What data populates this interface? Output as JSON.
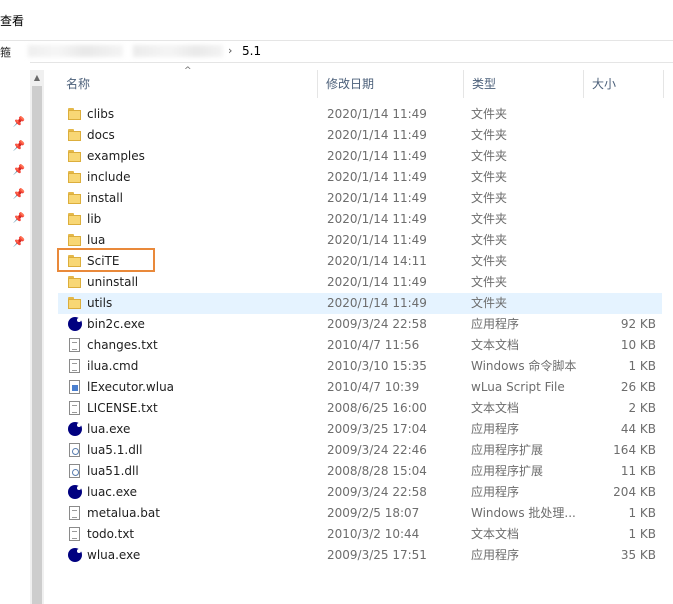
{
  "ribbon": {
    "view_tab": "查看"
  },
  "address": {
    "part0": "箍",
    "separator": "›",
    "current": "5.1"
  },
  "columns": {
    "name": "名称",
    "date": "修改日期",
    "type": "类型",
    "size": "大小"
  },
  "files": [
    {
      "name": "clibs",
      "date": "2020/1/14 11:49",
      "type": "文件夹",
      "size": "",
      "icon": "folder-icon"
    },
    {
      "name": "docs",
      "date": "2020/1/14 11:49",
      "type": "文件夹",
      "size": "",
      "icon": "folder-icon"
    },
    {
      "name": "examples",
      "date": "2020/1/14 11:49",
      "type": "文件夹",
      "size": "",
      "icon": "folder-icon"
    },
    {
      "name": "include",
      "date": "2020/1/14 11:49",
      "type": "文件夹",
      "size": "",
      "icon": "folder-icon"
    },
    {
      "name": "install",
      "date": "2020/1/14 11:49",
      "type": "文件夹",
      "size": "",
      "icon": "folder-icon"
    },
    {
      "name": "lib",
      "date": "2020/1/14 11:49",
      "type": "文件夹",
      "size": "",
      "icon": "folder-icon"
    },
    {
      "name": "lua",
      "date": "2020/1/14 11:49",
      "type": "文件夹",
      "size": "",
      "icon": "folder-icon"
    },
    {
      "name": "SciTE",
      "date": "2020/1/14 14:11",
      "type": "文件夹",
      "size": "",
      "icon": "folder-icon"
    },
    {
      "name": "uninstall",
      "date": "2020/1/14 11:49",
      "type": "文件夹",
      "size": "",
      "icon": "folder-icon"
    },
    {
      "name": "utils",
      "date": "2020/1/14 11:49",
      "type": "文件夹",
      "size": "",
      "icon": "folder-icon"
    },
    {
      "name": "bin2c.exe",
      "date": "2009/3/24 22:58",
      "type": "应用程序",
      "size": "92 KB",
      "icon": "lua-exe-icon"
    },
    {
      "name": "changes.txt",
      "date": "2010/4/7 11:56",
      "type": "文本文档",
      "size": "10 KB",
      "icon": "text-file-icon"
    },
    {
      "name": "ilua.cmd",
      "date": "2010/3/10 15:35",
      "type": "Windows 命令脚本",
      "size": "1 KB",
      "icon": "script-file-icon"
    },
    {
      "name": "lExecutor.wlua",
      "date": "2010/4/7 10:39",
      "type": "wLua Script File",
      "size": "26 KB",
      "icon": "wlua-file-icon"
    },
    {
      "name": "LICENSE.txt",
      "date": "2008/6/25 16:00",
      "type": "文本文档",
      "size": "2 KB",
      "icon": "text-file-icon"
    },
    {
      "name": "lua.exe",
      "date": "2009/3/25 17:04",
      "type": "应用程序",
      "size": "44 KB",
      "icon": "lua-exe-icon"
    },
    {
      "name": "lua5.1.dll",
      "date": "2009/3/24 22:46",
      "type": "应用程序扩展",
      "size": "164 KB",
      "icon": "dll-file-icon"
    },
    {
      "name": "lua51.dll",
      "date": "2008/8/28 15:04",
      "type": "应用程序扩展",
      "size": "11 KB",
      "icon": "dll-file-icon"
    },
    {
      "name": "luac.exe",
      "date": "2009/3/24 22:58",
      "type": "应用程序",
      "size": "204 KB",
      "icon": "lua-exe-icon"
    },
    {
      "name": "metalua.bat",
      "date": "2009/2/5 18:07",
      "type": "Windows 批处理...",
      "size": "1 KB",
      "icon": "script-file-icon"
    },
    {
      "name": "todo.txt",
      "date": "2010/3/2 10:44",
      "type": "文本文档",
      "size": "1 KB",
      "icon": "text-file-icon"
    },
    {
      "name": "wlua.exe",
      "date": "2009/3/25 17:51",
      "type": "应用程序",
      "size": "35 KB",
      "icon": "lua-exe-icon"
    }
  ],
  "colors": {
    "highlight_box": "#e9893a",
    "hover_row": "#e5f3ff",
    "header_text": "#4c607a"
  }
}
